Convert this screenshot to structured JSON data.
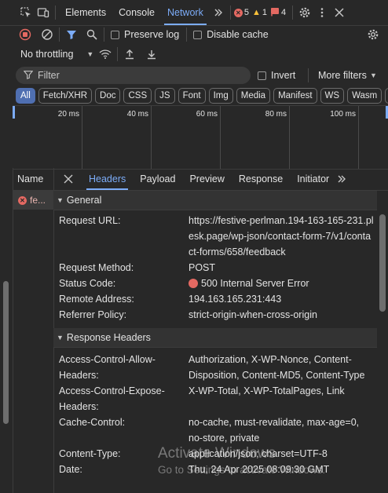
{
  "topbar": {
    "tabs": [
      {
        "label": "Elements"
      },
      {
        "label": "Console"
      },
      {
        "label": "Network"
      }
    ],
    "errors_count": "5",
    "warnings_count": "1",
    "issues_count": "4"
  },
  "toolbar": {
    "preserve_log": "Preserve log",
    "disable_cache": "Disable cache",
    "throttling": "No throttling"
  },
  "filter": {
    "placeholder": "Filter",
    "invert": "Invert",
    "more_filters": "More filters"
  },
  "types": [
    "All",
    "Fetch/XHR",
    "Doc",
    "CSS",
    "JS",
    "Font",
    "Img",
    "Media",
    "Manifest",
    "WS",
    "Wasm",
    "O"
  ],
  "timeline": {
    "ticks": [
      "20 ms",
      "40 ms",
      "60 ms",
      "80 ms",
      "100 ms"
    ]
  },
  "requests": {
    "column_name": "Name",
    "items": [
      {
        "name": "fe..."
      }
    ]
  },
  "details": {
    "tabs": [
      "Headers",
      "Payload",
      "Preview",
      "Response",
      "Initiator"
    ],
    "general": {
      "title": "General",
      "request_url_label": "Request URL:",
      "request_url": "https://festive-perlman.194-163-165-231.plesk.page/wp-json/contact-form-7/v1/contact-forms/658/feedback",
      "method_label": "Request Method:",
      "method": "POST",
      "status_label": "Status Code:",
      "status": "500 Internal Server Error",
      "remote_label": "Remote Address:",
      "remote": "194.163.165.231:443",
      "referrer_label": "Referrer Policy:",
      "referrer": "strict-origin-when-cross-origin"
    },
    "response_headers": {
      "title": "Response Headers",
      "acah_label": "Access-Control-Allow-Headers:",
      "acah": "Authorization, X-WP-Nonce, Content-Disposition, Content-MD5, Content-Type",
      "aceh_label": "Access-Control-Expose-Headers:",
      "aceh": "X-WP-Total, X-WP-TotalPages, Link",
      "cc_label": "Cache-Control:",
      "cc": "no-cache, must-revalidate, max-age=0, no-store, private",
      "ct_label": "Content-Type:",
      "ct": "application/json; charset=UTF-8",
      "date_label": "Date:",
      "date": "Thu, 24 Apr 2025 08:09:30 GMT"
    }
  },
  "watermark": {
    "line1": "Activate Windows",
    "line2": "Go to Settings to activate Windows."
  },
  "colors": {
    "accent": "#7cacf8",
    "error": "#e46962",
    "active_chip": "#4f6fb1"
  }
}
